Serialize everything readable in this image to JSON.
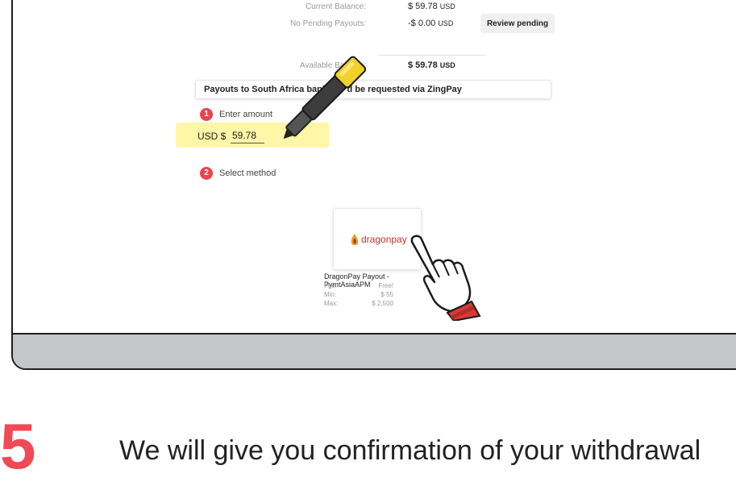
{
  "balances": [
    {
      "label": "Current Balance:",
      "value": "$ 59.78",
      "unit": "USD",
      "bold": false
    },
    {
      "label": "No Pending Payouts:",
      "value": "-$ 0.00",
      "unit": "USD",
      "bold": false
    },
    {
      "label": "Available Balance:",
      "value": "$ 59.78",
      "unit": "USD",
      "bold": true
    }
  ],
  "review_button": "Review pending",
  "notice": "Payouts to South Africa banke      d be requested via ZingPay",
  "steps": [
    {
      "num": "1",
      "label": "Enter amount"
    },
    {
      "num": "2",
      "label": "Select method"
    }
  ],
  "amount": {
    "prefix": "USD $",
    "value": "59.78"
  },
  "method": {
    "logo_text": "dragonpay",
    "name": "DragonPay Payout - PymtAsiaAPM",
    "fees": [
      {
        "k": "Fee:",
        "v": "Free!"
      },
      {
        "k": "Min:",
        "v": "$ 55"
      },
      {
        "k": "Max:",
        "v": "$ 2,500"
      }
    ]
  },
  "step_number": "5",
  "instruction": "We will give you confirmation of your withdrawal",
  "colors": {
    "accent": "#e8454f",
    "highlight": "#fff59d",
    "pen": "#f2d22a"
  },
  "icons": [
    "marker-pen-icon",
    "hand-pointer-icon",
    "dragonpay-logo-icon"
  ]
}
